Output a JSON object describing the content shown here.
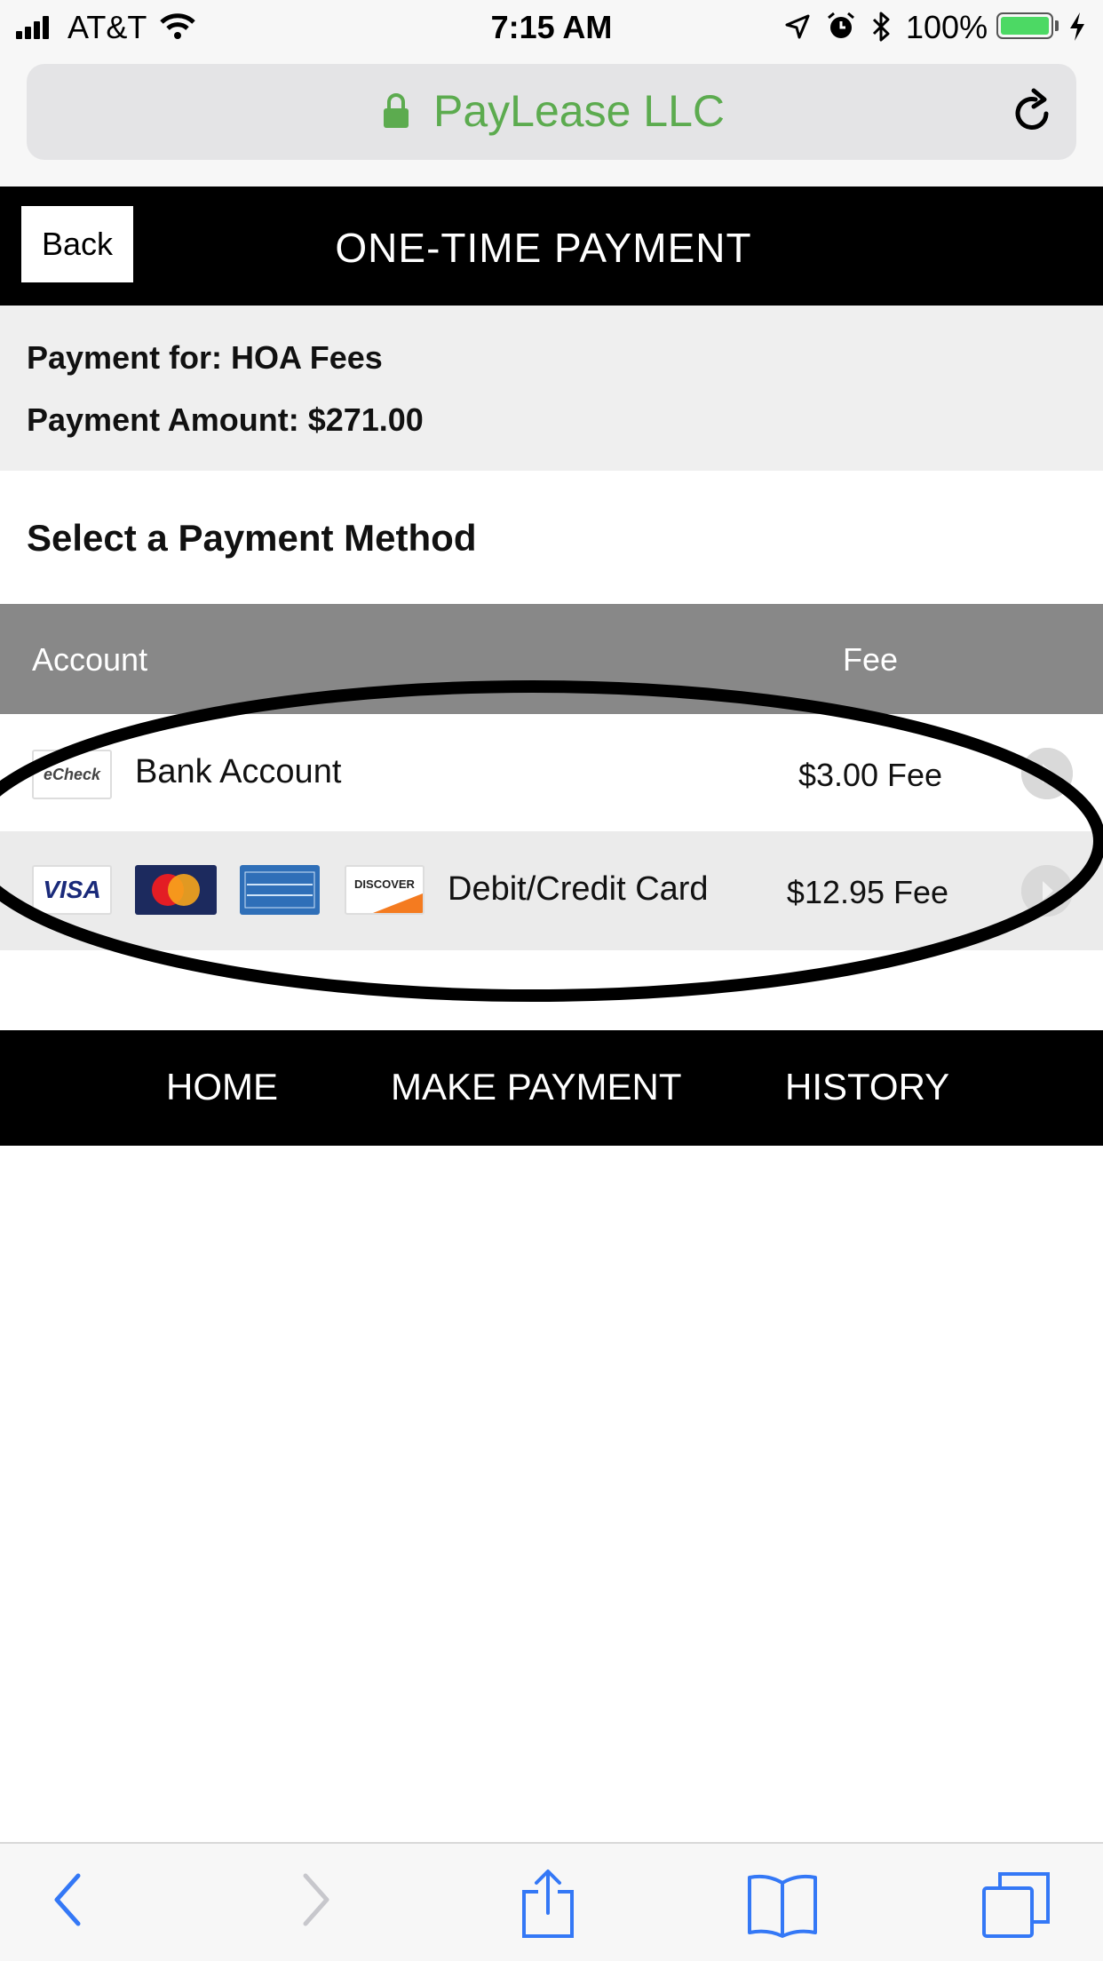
{
  "status_bar": {
    "carrier": "AT&T",
    "time": "7:15 AM",
    "battery": "100%",
    "battery_level": 1.0,
    "signal_icon": "signal-bars-icon",
    "wifi_icon": "wifi-icon"
  },
  "browser": {
    "site_name": "PayLease LLC",
    "site_color": "#5cab4f"
  },
  "header": {
    "back_label": "Back",
    "title": "ONE-TIME PAYMENT"
  },
  "summary": {
    "payment_for": "Payment for: HOA Fees",
    "payment_amount": "Payment Amount: $271.00"
  },
  "select_title": "Select a Payment Method",
  "table": {
    "columns": [
      "Account",
      "Fee"
    ],
    "rows": [
      {
        "label": "Bank Account",
        "fee": "$3.00 Fee",
        "logos": [
          "eCheck"
        ]
      },
      {
        "label": "Debit/Credit Card",
        "fee": "$12.95 Fee",
        "logos": [
          "VISA",
          "MasterCard",
          "AMERICAN EXPRESS",
          "DISCOVER"
        ]
      }
    ]
  },
  "nav": {
    "items": [
      "HOME",
      "MAKE PAYMENT",
      "HISTORY"
    ]
  },
  "toolbar": {
    "icons": [
      "back-icon",
      "forward-icon",
      "share-icon",
      "bookmarks-icon",
      "tabs-icon"
    ]
  },
  "colors": {
    "header_bg": "#000000",
    "summary_bg": "#efefef",
    "table_head_bg": "#888888",
    "accent_green": "#5cab4f"
  }
}
